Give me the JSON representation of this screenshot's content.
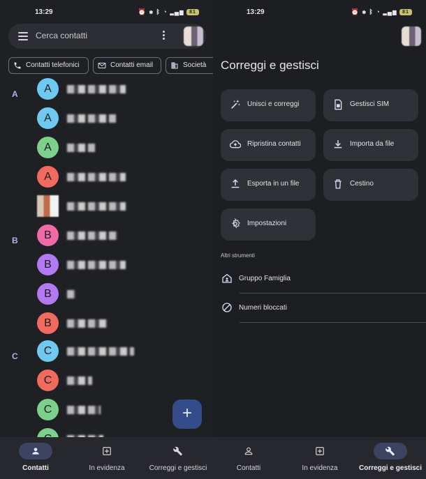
{
  "status": {
    "time": "13:29",
    "battery": "81"
  },
  "search": {
    "placeholder": "Cerca contatti"
  },
  "chips": [
    {
      "label": "Contatti telefonici",
      "icon": "phone-icon"
    },
    {
      "label": "Contatti email",
      "icon": "mail-icon"
    },
    {
      "label": "Società",
      "icon": "building-icon"
    }
  ],
  "sections": [
    {
      "letter": "A",
      "contacts": [
        {
          "initial": "A",
          "color": "#6fc8ef"
        },
        {
          "initial": "A",
          "color": "#6fc8ef"
        },
        {
          "initial": "A",
          "color": "#7dd08b"
        },
        {
          "initial": "A",
          "color": "#f06b5d"
        },
        {
          "initial": "",
          "color": "photo"
        }
      ]
    },
    {
      "letter": "B",
      "contacts": [
        {
          "initial": "B",
          "color": "#f06aa8"
        },
        {
          "initial": "B",
          "color": "#b279f0"
        },
        {
          "initial": "B",
          "color": "#b279f0"
        },
        {
          "initial": "B",
          "color": "#f06b5d"
        }
      ]
    },
    {
      "letter": "C",
      "contacts": [
        {
          "initial": "C",
          "color": "#6fc8ef"
        },
        {
          "initial": "C",
          "color": "#f06b5d"
        },
        {
          "initial": "C",
          "color": "#7dd08b"
        },
        {
          "initial": "C",
          "color": "#7dd08b"
        }
      ]
    }
  ],
  "fab": {
    "label": "+"
  },
  "nav": {
    "contatti": "Contatti",
    "evidenza": "In evidenza",
    "correggi": "Correggi e gestisci"
  },
  "manage": {
    "title": "Correggi e gestisci",
    "tools": [
      {
        "label": "Unisci e correggi",
        "icon": "magic-wand-icon"
      },
      {
        "label": "Gestisci SIM",
        "icon": "sim-card-icon"
      },
      {
        "label": "Ripristina contatti",
        "icon": "cloud-restore-icon"
      },
      {
        "label": "Importa da file",
        "icon": "download-icon"
      },
      {
        "label": "Esporta in un file",
        "icon": "upload-icon"
      },
      {
        "label": "Cestino",
        "icon": "trash-icon"
      },
      {
        "label": "Impostazioni",
        "icon": "gear-icon"
      }
    ],
    "other_label": "Altri strumenti",
    "other": [
      {
        "label": "Gruppo Famiglia",
        "icon": "family-home-icon"
      },
      {
        "label": "Numeri bloccati",
        "icon": "block-icon"
      }
    ]
  },
  "colors": {
    "accent": "#344b8c",
    "active_pill": "#3d4260",
    "letter": "#aab4e8"
  }
}
